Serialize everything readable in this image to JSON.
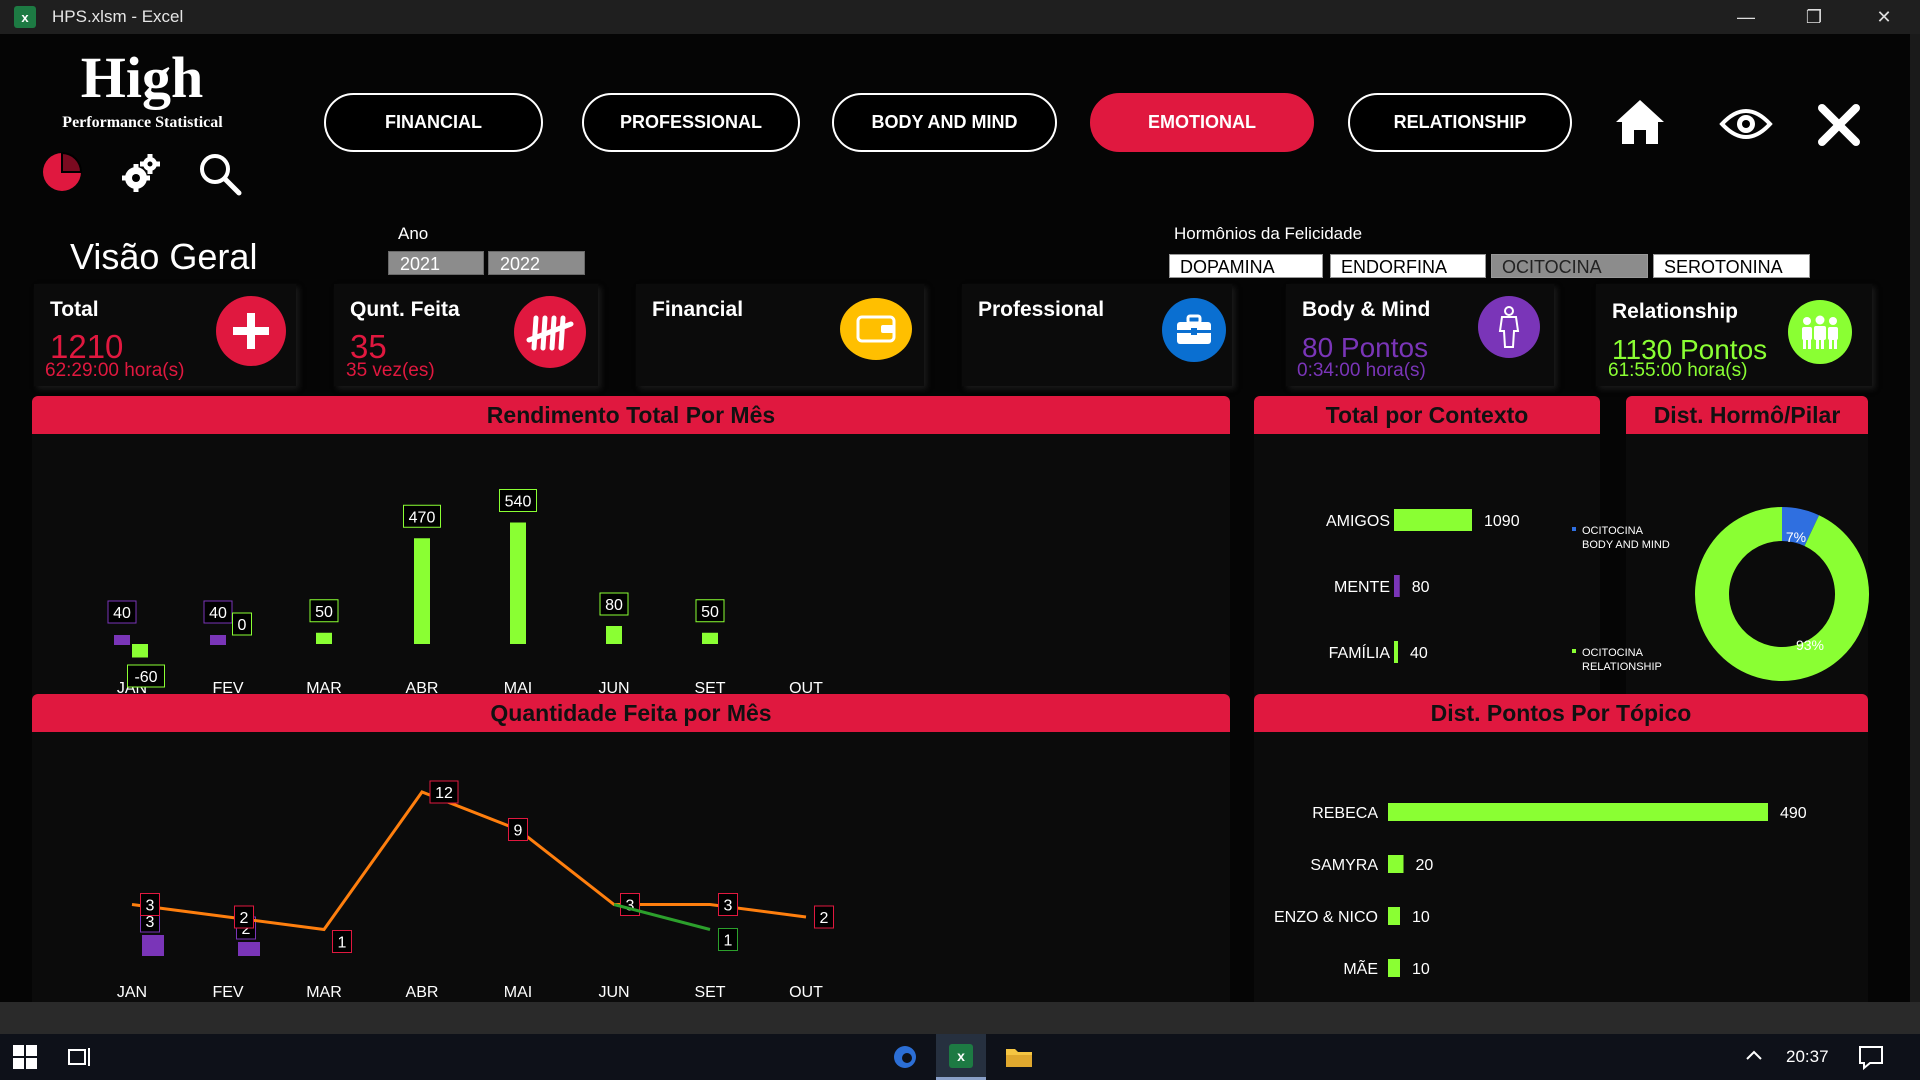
{
  "window": {
    "icon_text": "x",
    "title": "HPS.xlsm - Excel",
    "minimize": "—",
    "restore": "❐",
    "close": "✕"
  },
  "logo": {
    "title": "High",
    "subtitle": "Performance Statistical"
  },
  "nav": [
    {
      "label": "FINANCIAL",
      "active": false
    },
    {
      "label": "PROFESSIONAL",
      "active": false
    },
    {
      "label": "BODY AND MIND",
      "active": false
    },
    {
      "label": "EMOTIONAL",
      "active": true
    },
    {
      "label": "RELATIONSHIP",
      "active": false
    }
  ],
  "overview": {
    "title": "Visão Geral"
  },
  "year": {
    "label": "Ano",
    "options": [
      "2021",
      "2022"
    ]
  },
  "hormones": {
    "label": "Hormônios da Felicidade",
    "options": [
      "DOPAMINA",
      "ENDORFINA",
      "OCITOCINA",
      "SEROTONINA"
    ],
    "selected": "OCITOCINA"
  },
  "cards": {
    "total": {
      "title": "Total",
      "value": "1210",
      "sub": "62:29:00 hora(s)"
    },
    "qty": {
      "title": "Qunt. Feita",
      "value": "35",
      "sub": "35 vez(es)"
    },
    "financial": {
      "title": "Financial"
    },
    "professional": {
      "title": "Professional"
    },
    "body": {
      "title": "Body & Mind",
      "value": "80 Pontos",
      "sub": "0:34:00 hora(s)"
    },
    "relationship": {
      "title": "Relationship",
      "value": "1130 Pontos",
      "sub": "61:55:00 hora(s)"
    }
  },
  "colors": {
    "accent": "#e0183f",
    "green": "#8aff33",
    "purple": "#7a35b8",
    "orange": "#ff7f0e",
    "blue": "#2f6fe0",
    "yellow": "#ffbf00"
  },
  "chart_data": [
    {
      "type": "bar",
      "title": "Rendimento Total Por Mês",
      "categories": [
        "JAN",
        "FEV",
        "MAR",
        "ABR",
        "MAI",
        "JUN",
        "SET",
        "OUT"
      ],
      "series": [
        {
          "values": [
            40,
            40,
            null,
            null,
            null,
            null,
            null,
            null
          ],
          "color": "#7a35b8"
        },
        {
          "values": [
            -60,
            0,
            50,
            470,
            540,
            80,
            50,
            null
          ],
          "color": "#8aff33"
        }
      ]
    },
    {
      "type": "line",
      "title": "Quantidade Feita por Mês",
      "categories": [
        "JAN",
        "FEV",
        "MAR",
        "ABR",
        "MAI",
        "JUN",
        "SET",
        "OUT"
      ],
      "series": [
        {
          "values": [
            3,
            2,
            1,
            12,
            9,
            3,
            3,
            2
          ],
          "color": "#ff7f0e",
          "kind": "line"
        },
        {
          "values": [
            null,
            null,
            null,
            null,
            null,
            3,
            1,
            null
          ],
          "color": "#2ca02c",
          "kind": "line"
        },
        {
          "values": [
            3,
            2,
            null,
            null,
            null,
            null,
            null,
            null
          ],
          "color": "#7a35b8",
          "kind": "bar"
        }
      ]
    },
    {
      "type": "bar",
      "title": "Total por Contexto",
      "categories": [
        "AMIGOS",
        "MENTE",
        "FAMÍLIA"
      ],
      "values": [
        1090,
        80,
        40
      ],
      "colors": [
        "#8aff33",
        "#7a35b8",
        "#8aff33"
      ]
    },
    {
      "type": "pie",
      "title": "Dist. Hormô/Pilar",
      "labels": [
        "OCITOCINA BODY AND MIND",
        "OCITOCINA RELATIONSHIP"
      ],
      "legend": [
        [
          "OCITOCINA",
          "BODY AND MIND"
        ],
        [
          "OCITOCINA",
          "RELATIONSHIP"
        ]
      ],
      "values": [
        7,
        93
      ],
      "value_labels": [
        "7%",
        "93%"
      ],
      "colors": [
        "#2f6fe0",
        "#8aff33"
      ]
    },
    {
      "type": "bar",
      "title": "Dist. Pontos Por Tópico",
      "categories": [
        "REBECA",
        "SAMYRA",
        "ENZO & NICO",
        "MÃE"
      ],
      "values": [
        490,
        20,
        10,
        10
      ],
      "colors": [
        "#8aff33",
        "#8aff33",
        "#8aff33",
        "#8aff33"
      ]
    }
  ],
  "taskbar": {
    "time": "20:37"
  }
}
